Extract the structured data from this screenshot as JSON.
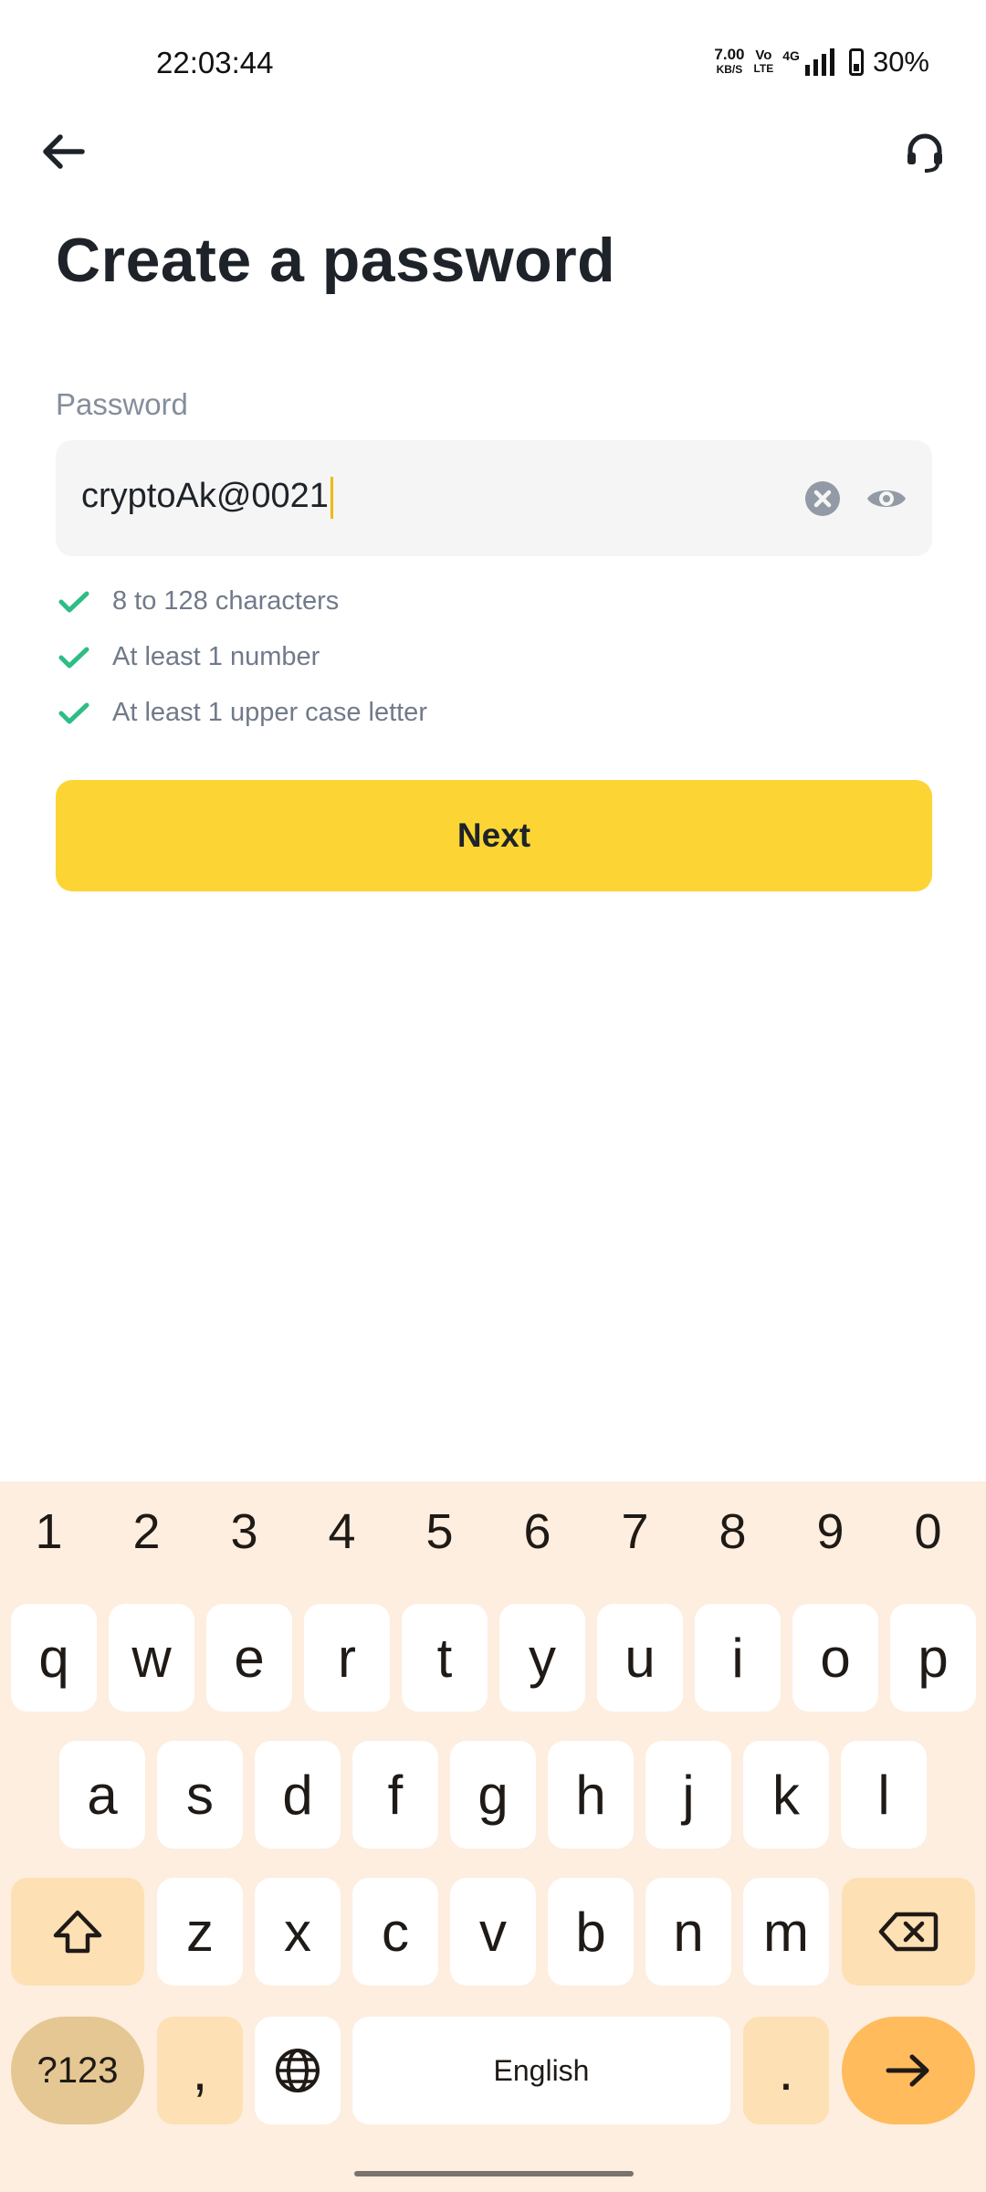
{
  "status_bar": {
    "time": "22:03:44",
    "net_speed_value": "7.00",
    "net_speed_unit": "KB/S",
    "volte_top": "Vo",
    "volte_bottom": "LTE",
    "network": "4G",
    "battery_percent": "30%"
  },
  "nav": {
    "back_icon": "arrow-left-icon",
    "support_icon": "headset-icon"
  },
  "page": {
    "title": "Create a password"
  },
  "password": {
    "label": "Password",
    "value": "cryptoAk@0021",
    "clear_icon": "clear-circle-icon",
    "visibility_icon": "eye-icon"
  },
  "rules": [
    {
      "text": "8 to 128 characters",
      "satisfied": true
    },
    {
      "text": "At least 1 number",
      "satisfied": true
    },
    {
      "text": "At least 1 upper case letter",
      "satisfied": true
    }
  ],
  "next_label": "Next",
  "colors": {
    "accent_yellow": "#fcd535",
    "check_green": "#2ebd85",
    "caret": "#f0b90b",
    "keyboard_bg": "#fdeedf"
  },
  "keyboard": {
    "numbers": [
      "1",
      "2",
      "3",
      "4",
      "5",
      "6",
      "7",
      "8",
      "9",
      "0"
    ],
    "row1": [
      "q",
      "w",
      "e",
      "r",
      "t",
      "y",
      "u",
      "i",
      "o",
      "p"
    ],
    "row2": [
      "a",
      "s",
      "d",
      "f",
      "g",
      "h",
      "j",
      "k",
      "l"
    ],
    "row3": [
      "z",
      "x",
      "c",
      "v",
      "b",
      "n",
      "m"
    ],
    "symbols_label": "?123",
    "comma": ",",
    "space_label": "English",
    "period": ".",
    "shift_icon": "shift-icon",
    "backspace_icon": "backspace-icon",
    "globe_icon": "globe-icon",
    "enter_icon": "arrow-right-icon"
  }
}
